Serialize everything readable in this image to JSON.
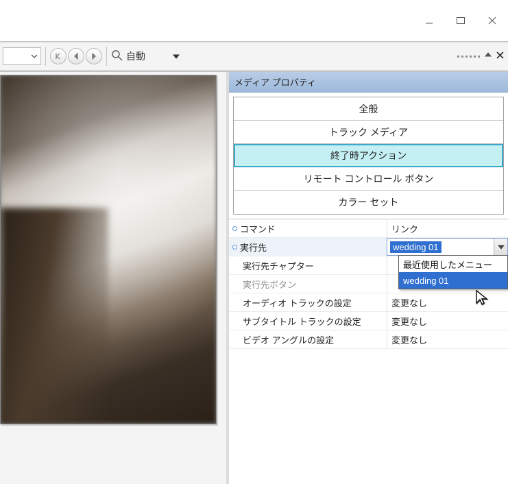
{
  "window": {
    "minimize_tooltip": "Minimize",
    "maximize_tooltip": "Maximize",
    "close_tooltip": "Close"
  },
  "toolbar": {
    "zoom_label": "自動",
    "nav": {
      "first": "first",
      "prev": "prev",
      "next": "next"
    }
  },
  "panel": {
    "title": "メディア プロパティ",
    "categories": [
      {
        "label": "全般",
        "active": false
      },
      {
        "label": "トラック メディア",
        "active": false
      },
      {
        "label": "終了時アクション",
        "active": true
      },
      {
        "label": "リモート コントロール ボタン",
        "active": false
      },
      {
        "label": "カラー セット",
        "active": false
      }
    ]
  },
  "properties": {
    "rows": [
      {
        "bullet": true,
        "label": "コマンド",
        "value": "リンク",
        "dim": false
      },
      {
        "bullet": true,
        "label": "実行先",
        "value": "wedding 01",
        "combo": true
      },
      {
        "bullet": false,
        "label": "実行先チャプター",
        "value": "",
        "dim": false
      },
      {
        "bullet": false,
        "label": "実行先ボタン",
        "value": "",
        "dim": true
      },
      {
        "bullet": false,
        "label": "オーディオ トラックの設定",
        "value": "変更なし",
        "dim": false
      },
      {
        "bullet": false,
        "label": "サブタイトル トラックの設定",
        "value": "変更なし",
        "dim": false
      },
      {
        "bullet": false,
        "label": "ビデオ アングルの設定",
        "value": "変更なし",
        "dim": false
      }
    ],
    "dropdown": {
      "options": [
        "最近使用したメニュー",
        "wedding 01"
      ],
      "highlighted_index": 1
    }
  }
}
